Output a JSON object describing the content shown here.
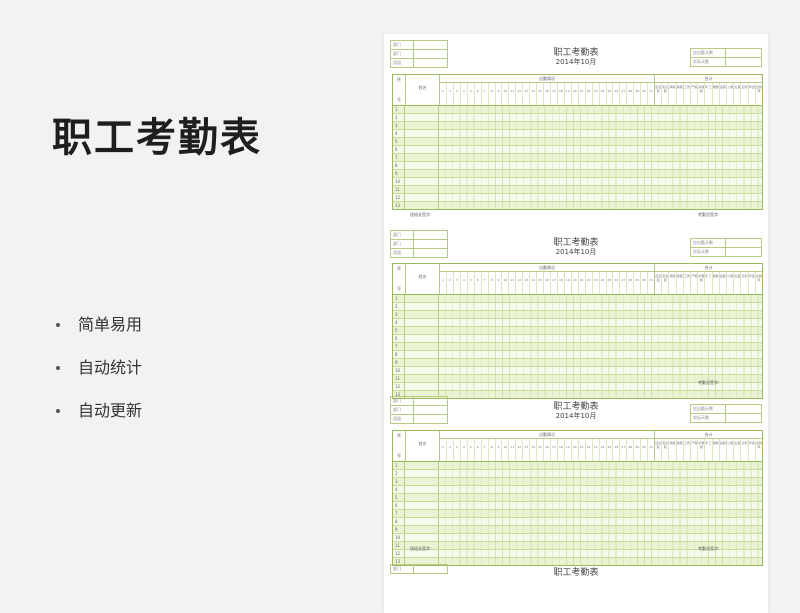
{
  "promo": {
    "title": "职工考勤表",
    "features": [
      "简单易用",
      "自动统计",
      "自动更新"
    ]
  },
  "sheet": {
    "title": "职工考勤表",
    "period": "2014年10月",
    "left_info": [
      "部门",
      "部门",
      "班组"
    ],
    "right_info": [
      "应出勤天数",
      "实际天数"
    ],
    "col_seq": [
      "序",
      "号"
    ],
    "col_name": "姓名",
    "attendance_header": "出勤情况",
    "days": [
      "1",
      "2",
      "3",
      "4",
      "5",
      "6",
      "7",
      "8",
      "9",
      "10",
      "11",
      "12",
      "13",
      "14",
      "15",
      "16",
      "17",
      "18",
      "19",
      "20",
      "21",
      "22",
      "23",
      "24",
      "25",
      "26",
      "27",
      "28",
      "29",
      "30",
      "31"
    ],
    "summary_header": "合计",
    "summary_cols": [
      "应出勤",
      "实出勤",
      "病假",
      "事假",
      "工伤",
      "产假",
      "护理假",
      "旷工",
      "婚假",
      "丧假",
      "公假",
      "出差",
      "迟到",
      "早退",
      "出勤率"
    ],
    "rows": [
      "1",
      "2",
      "3",
      "4",
      "5",
      "6",
      "7",
      "8",
      "9",
      "10",
      "11",
      "12",
      "13"
    ],
    "sign_left": "班组长签字:",
    "sign_right": "考勤员签字:"
  },
  "accent_color": "#9ab95a",
  "row_color": "#eaf4d4"
}
